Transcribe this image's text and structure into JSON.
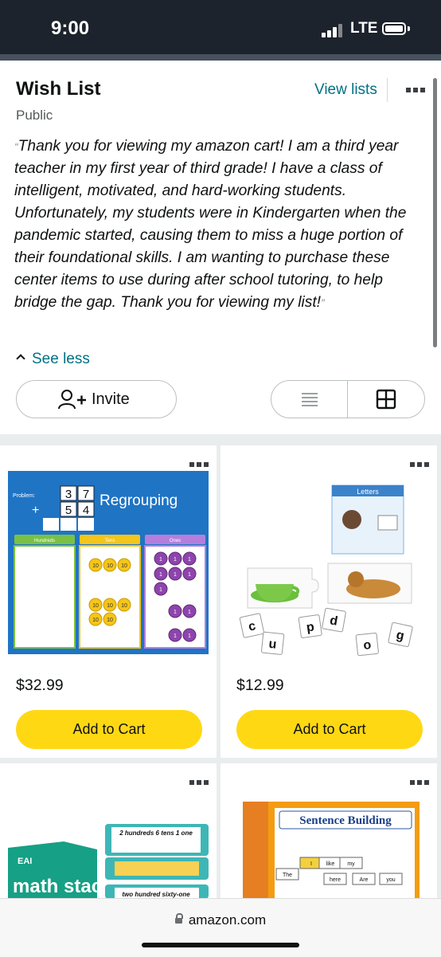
{
  "status_bar": {
    "time": "9:00",
    "network": "LTE"
  },
  "wishlist": {
    "title": "Wish List",
    "privacy": "Public",
    "view_lists": "View lists",
    "open_quote": "“",
    "close_quote": "”",
    "description": "Thank you for viewing my amazon cart! I am a third year teacher in my first year of third grade! I have a class of intelligent, motivated, and hard-working students. Unfortunately, my students were in Kindergarten when the pandemic started, causing them to miss a huge portion of their foundational skills. I am wanting to purchase these center items to use during after school tutoring, to help bridge the gap. Thank you for viewing my list!",
    "see_less": "See less",
    "invite": "Invite",
    "view_mode": "grid"
  },
  "items": [
    {
      "price": "$32.99",
      "add_to_cart": "Add to Cart",
      "image_text": {
        "problem": "Problem:",
        "digits": [
          "3",
          "7",
          "5",
          "4"
        ],
        "plus": "+",
        "heading": "Regrouping",
        "columns": [
          "Hundreds",
          "Tens",
          "Ones"
        ],
        "coin_tens": "10",
        "coin_ones": "1"
      }
    },
    {
      "price": "$12.99",
      "add_to_cart": "Add to Cart",
      "image_text": {
        "box_label": "Letters",
        "tiles": [
          "c",
          "u",
          "p",
          "d",
          "o",
          "g"
        ]
      }
    },
    {
      "price": "",
      "add_to_cart": "",
      "image_text": {
        "brand": "EAI",
        "title": "math stacks",
        "card_1": "2 hundreds 6 tens 1 one",
        "card_2": "two hundred sixty-one"
      }
    },
    {
      "price": "",
      "add_to_cart": "",
      "image_text": {
        "title": "Sentence Building",
        "side": "Sentence Building",
        "words": [
          "The",
          "I",
          "like",
          "my",
          "here",
          "Are",
          "you"
        ]
      }
    }
  ],
  "browser": {
    "url": "amazon.com"
  },
  "colors": {
    "link": "#007185",
    "button": "#ffd814",
    "status_bar": "#1c232c",
    "background_grey": "#eaeded"
  }
}
